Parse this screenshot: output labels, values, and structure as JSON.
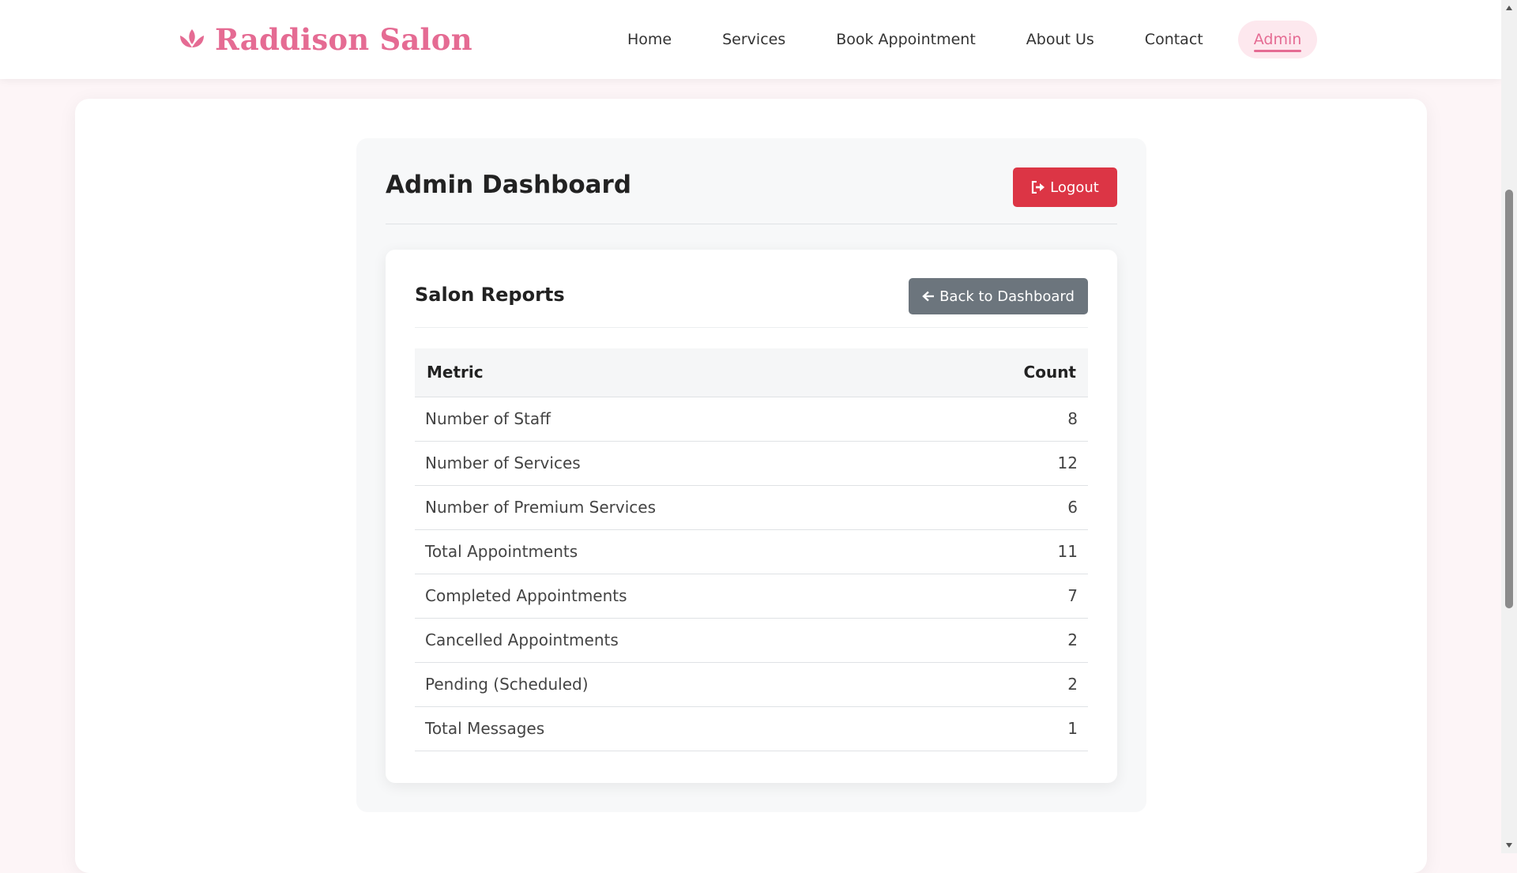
{
  "brand": {
    "name": "Raddison Salon",
    "icon": "lotus-icon",
    "color": "#e56b93"
  },
  "nav": {
    "items": [
      {
        "label": "Home"
      },
      {
        "label": "Services"
      },
      {
        "label": "Book Appointment"
      },
      {
        "label": "About Us"
      },
      {
        "label": "Contact"
      },
      {
        "label": "Admin",
        "active": true
      }
    ]
  },
  "admin": {
    "title": "Admin Dashboard",
    "logout_label": "Logout",
    "logout_icon": "logout-icon",
    "logout_color": "#dc3545"
  },
  "reports": {
    "title": "Salon Reports",
    "back_label": "Back to Dashboard",
    "back_icon": "arrow-left-icon",
    "back_color": "#6c757d",
    "columns": [
      "Metric",
      "Count"
    ],
    "rows": [
      {
        "metric": "Number of Staff",
        "count": "8"
      },
      {
        "metric": "Number of Services",
        "count": "12"
      },
      {
        "metric": "Number of Premium Services",
        "count": "6"
      },
      {
        "metric": "Total Appointments",
        "count": "11"
      },
      {
        "metric": "Completed Appointments",
        "count": "7"
      },
      {
        "metric": "Cancelled Appointments",
        "count": "2"
      },
      {
        "metric": "Pending (Scheduled)",
        "count": "2"
      },
      {
        "metric": "Total Messages",
        "count": "1"
      }
    ]
  }
}
